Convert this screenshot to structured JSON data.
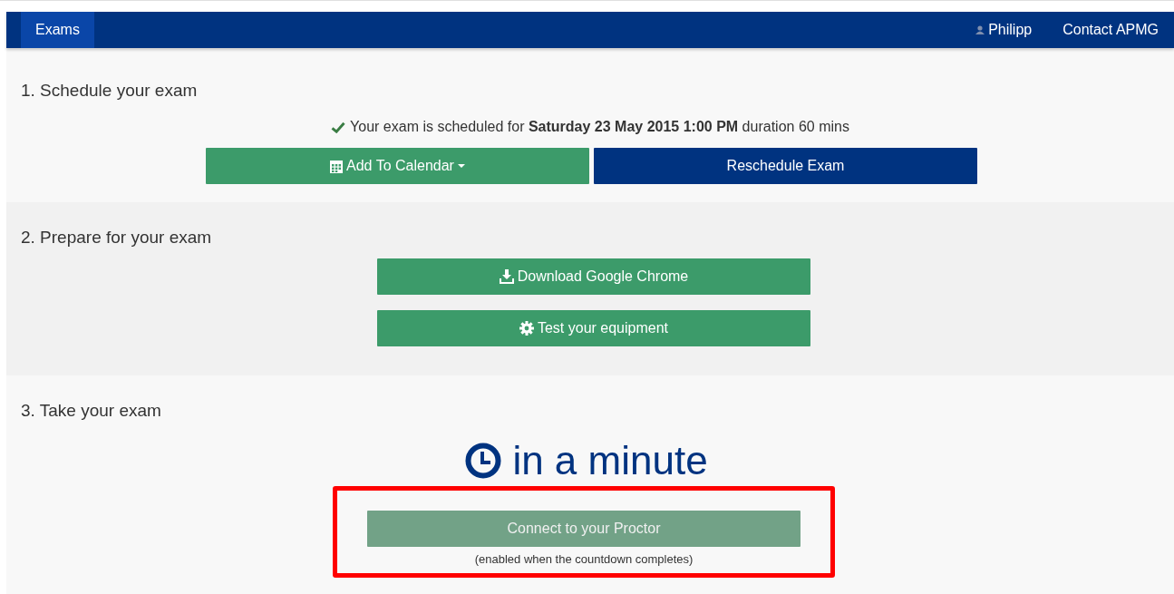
{
  "navbar": {
    "items": [
      {
        "label": "Exams",
        "selected": true
      }
    ],
    "user": "Philipp",
    "contact": "Contact APMG"
  },
  "sections": [
    {
      "heading": "1. Schedule your exam",
      "status": "Your exam is scheduled for **Saturday 23 May 2015 1:00 PM** duration 60 mins",
      "buttons": [
        {
          "label": "Add To Calendar"
        },
        {
          "label": "Reschedule Exam"
        }
      ]
    },
    {
      "heading": "2. Prepare for your exam",
      "stacked_buttons": [
        {
          "label": "Download Google Chrome"
        },
        {
          "label": "Test your equipment"
        }
      ]
    },
    {
      "heading": "3. Take your exam",
      "countdown": "in a minute",
      "connect": {
        "label": "Connect to your Proctor",
        "disabled": true,
        "note": "(enabled when the countdown completes)",
        "highlighted": true
      }
    }
  ]
}
